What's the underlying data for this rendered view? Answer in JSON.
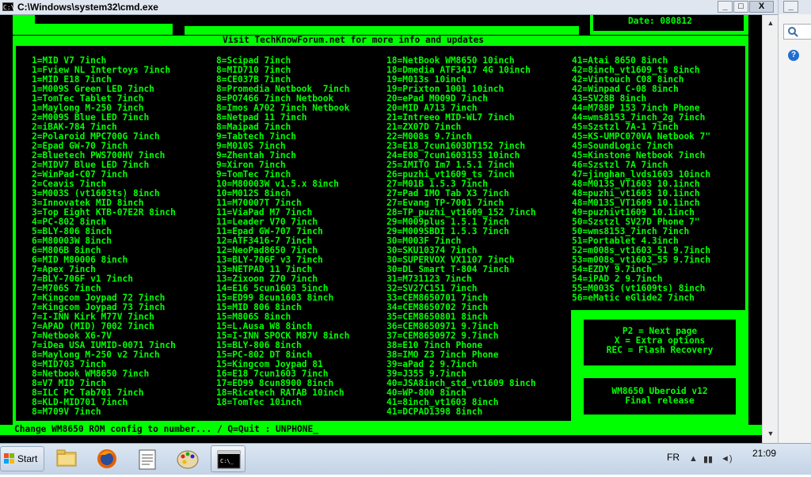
{
  "window": {
    "title": "C:\\Windows\\system32\\cmd.exe",
    "icon_label": "C:\\",
    "buttons": {
      "minimize": "_",
      "maximize": "□",
      "close": "X"
    }
  },
  "console": {
    "date_line": "Date: 080812",
    "header": "Visit TechKnowForum.net for more info and updates",
    "columns": [
      [
        "1=MID V7 7inch",
        "1=Fview NL Intertoys 7inch",
        "1=MID E18 7inch",
        "1=M009S Green LED 7inch",
        "1=TomTec Tablet 7inch",
        "1=Maylong M-250 7inch",
        "2=M009S Blue LED 7inch",
        "2=iBAK-784 7inch",
        "2=Polaroid MPC700G 7inch",
        "2=Epad GW-70 7inch",
        "2=Bluetech PWS700HV 7inch",
        "2=MIDV7 Blue LED 7inch",
        "2=WinPad-C07 7inch",
        "2=Ceavis 7inch",
        "3=M003S (vt1603ts) 8inch",
        "3=Innovatek MID 8inch",
        "3=Top Eight KTB-07E2R 8inch",
        "4=PC-802 8inch",
        "5=BLY-806 8inch",
        "6=M80003W 8inch",
        "6=M806B 8inch",
        "6=MID M80006 8inch",
        "7=Apex 7inch",
        "7=BLY-706F v1 7inch",
        "7=M706S 7inch",
        "7=Kingcom Joypad 72 7inch",
        "7=Kingcom Joypad 73 7inch",
        "7=I-INN Kirk M77V 7inch",
        "7=APAD (MID) 7002 7inch",
        "7=Netbook X6-7V",
        "7=iDea USA IUMID-0071 7inch",
        "8=Maylong M-250 v2 7inch",
        "8=MID703 7inch",
        "8=Netbook WM8650 7inch",
        "8=V7 MID 7inch",
        "8=ILC PC Tab701 7inch",
        "8=KLD-MID701 7inch",
        "8=M709V 7inch"
      ],
      [
        "8=Scipad 7inch",
        "8=MID710 7inch",
        "8=CE037B 7inch",
        "8=Promedia Netbook  7inch",
        "8=PO7466 7inch Netbook",
        "8=Imos A702 7inch Netbook",
        "8=Netpad 11 7inch",
        "8=Maipad 7inch",
        "9=Tabtech 7inch",
        "9=M010S 7inch",
        "9=Zhentah 7inch",
        "9=Xiron 7inch",
        "9=TomTec 7inch",
        "10=M80003W v1.5.x 8inch",
        "10=M012S 8inch",
        "11=M70007T 7inch",
        "11=ViaPad M7 7inch",
        "11=Leader V70 7inch",
        "11=Epad GW-707 7inch",
        "12=ATF3416-7 7inch",
        "12=NeoPad8650 7inch",
        "13=BLY-706F v3 7inch",
        "13=NETPAD 11 7inch",
        "13=Zixoon Z70 7inch",
        "14=E16 5cun1603 5inch",
        "15=ED99 8cun1603 8inch",
        "15=MID 806 8inch",
        "15=M806S 8inch",
        "15=L.Ausa W8 8inch",
        "15=I-INN SPOCK M87V 8inch",
        "15=BLY-806 8inch",
        "15=PC-802 DT 8inch",
        "15=Kingcom Joypad 81",
        "16=E18 7cun1603 7inch",
        "17=ED99 8cun8900 8inch",
        "18=Ricatech RATAB 10inch",
        "18=TomTec 10inch"
      ],
      [
        "18=NetBook WM8650 10inch",
        "18=Dmedia ATF3417 4G 10inch",
        "19=M013s 10inch",
        "19=Prixton 1001 10inch",
        "20=ePad M009D 7inch",
        "20=MID A713 7inch",
        "21=Intreeo MID-WL7 7inch",
        "21=ZX07D 7inch",
        "22=M008s 9.7inch",
        "23=E18_7cun1603DT152 7inch",
        "24=E08_7cun1603153 10inch",
        "25=IMITO Im7 1.5.1 7inch",
        "26=puzhi_vt1609_ts 7inch",
        "27=M01B 1.5.3 7inch",
        "27=Pad IMO Tab X3 7inch",
        "27=Evang TP-7001 7inch",
        "28=TP_puzhi_vt1609_152 7inch",
        "29=M009plus 1.5.1 7inch",
        "29=M009SBDI 1.5.3 7inch",
        "30=M003F 7inch",
        "30=SKU10374 7inch",
        "30=SUPERVOX VX1107 7inch",
        "30=DL Smart T-804 7inch",
        "31=M731123 7inch",
        "32=SV27C151 7inch",
        "33=CEM8650701 7inch",
        "34=CEM8650702 7inch",
        "35=CEM8650801 8inch",
        "36=CEM8650971 9.7inch",
        "37=CEM8650972 9.7inch",
        "38=E10 7inch Phone",
        "38=IMO Z3 7inch Phone",
        "39=aPad 2 9.7inch",
        "39=J355 9.7inch",
        "40=JSA8inch_std_vt1609 8inch",
        "40=WP-800 8inch",
        "41=8inch_vt1603 8inch",
        "41=DCPAD1398 8inch"
      ],
      [
        "41=Atai 8650 8inch",
        "42=8inch_vt1609_ts 8inch",
        "42=Vintouch C08 8inch",
        "42=Winpad C-08 8inch",
        "43=SV28B 8inch",
        "44=M788P 153 7inch Phone",
        "44=wms8153_7inch_2g 7inch",
        "45=Szstzl 7A-1 7inch",
        "45=KS-UMPC070VA Netbook 7\"",
        "45=SoundLogic 7inch",
        "45=Kinstone Netbook 7inch",
        "46=Szstzl 7A 7inch",
        "47=jinghan_lvds1603 10inch",
        "48=M013S_VT1603 10.1inch",
        "48=puzhi_vt1603 10.1inch",
        "48=M013S_VT1609 10.1inch",
        "49=puzhivt1609 10.1inch",
        "50=Szstzl SV27D Phone 7\"",
        "50=wms8153_7inch 7inch",
        "51=Portablet 4.3inch",
        "52=m008s_vt1603_51 9.7inch",
        "53=m008s_vt1603_55 9.7inch",
        "54=EZDY 9.7inch",
        "54=iPAD 2 9.7inch",
        "55=M003S (vt1609ts) 8inch",
        "56=eMatic eGlide2 7inch"
      ]
    ],
    "options": [
      "P2 = Next page",
      "X = Extra options",
      "REC = Flash Recovery"
    ],
    "release": [
      "WM8650 Uberoid v12",
      "Final release"
    ],
    "prompt": "Change WM8650 ROM config to number... / Q=Quit : UNPHONE_"
  },
  "taskbar": {
    "start_label": "Start",
    "apps": [
      "file-explorer",
      "firefox",
      "notepad",
      "paint",
      "cmd"
    ],
    "language": "FR",
    "time": "21:09"
  },
  "colors": {
    "console_green": "#00ff00",
    "console_bg": "#000000"
  }
}
